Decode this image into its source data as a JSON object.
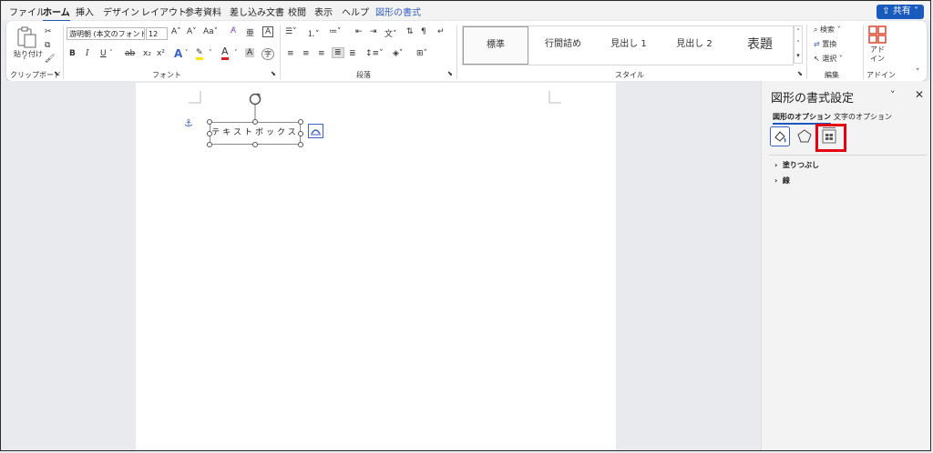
{
  "tabs": [
    "ファイル",
    "ホーム",
    "挿入",
    "デザイン",
    "レイアウト",
    "参考資料",
    "差し込み文書",
    "校閲",
    "表示",
    "ヘルプ",
    "図形の書式"
  ],
  "share_label": "共有",
  "ribbon": {
    "clipboard": {
      "paste_label": "貼り付け",
      "group_label": "クリップボード"
    },
    "font": {
      "font_name": "游明朝 (本文のフォント",
      "font_size": "12",
      "aa_label": "Aa",
      "group_label": "フォント"
    },
    "paragraph": {
      "group_label": "段落"
    },
    "styles": {
      "items": [
        "標準",
        "行間詰め",
        "見出し 1",
        "見出し 2",
        "表題"
      ],
      "group_label": "スタイル"
    },
    "editing": {
      "find_label": "検索",
      "replace_label": "置換",
      "select_label": "選択",
      "group_label": "編集"
    },
    "addins": {
      "label": "アド\nイン",
      "group_label": "アドイン"
    }
  },
  "document": {
    "textbox_text": "テキストボックス"
  },
  "pane": {
    "title": "図形の書式設定",
    "tabs": [
      "図形のオプション",
      "文字のオプション"
    ],
    "sections": [
      "塗りつぶし",
      "線"
    ]
  },
  "colors": {
    "accent": "#185abd",
    "highlight": "#e60012"
  }
}
